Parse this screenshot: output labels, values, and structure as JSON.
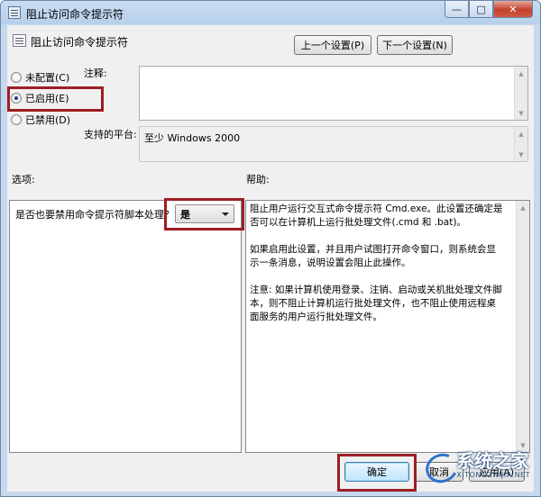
{
  "window": {
    "title": "阻止访问命令提示符",
    "controls": {
      "minimize": "—",
      "maximize": "□",
      "close": "✕"
    }
  },
  "header": {
    "setting_title": "阻止访问命令提示符",
    "prev_button": "上一个设置(P)",
    "next_button": "下一个设置(N)"
  },
  "state": {
    "options": [
      {
        "label": "未配置(C)",
        "checked": false
      },
      {
        "label": "已启用(E)",
        "checked": true
      },
      {
        "label": "已禁用(D)",
        "checked": false
      }
    ]
  },
  "comment": {
    "label": "注释:",
    "value": ""
  },
  "platform": {
    "label": "支持的平台:",
    "value": "至少 Windows 2000"
  },
  "options_section": {
    "label": "选项:",
    "question": "是否也要禁用命令提示符脚本处理？",
    "select_value": "是"
  },
  "help_section": {
    "label": "帮助:",
    "paragraphs": [
      "阻止用户运行交互式命令提示符 Cmd.exe。此设置还确定是否可以在计算机上运行批处理文件(.cmd 和 .bat)。",
      "如果启用此设置，并且用户试图打开命令窗口，则系统会显示一条消息，说明设置会阻止此操作。",
      "注意: 如果计算机使用登录、注销、启动或关机批处理文件脚本，则不阻止计算机运行批处理文件，也不阻止使用远程桌面服务的用户运行批处理文件。"
    ]
  },
  "footer": {
    "ok_button": "确定",
    "cancel_button": "取消",
    "apply_button": "应用(A)"
  },
  "watermark": {
    "main": "系统之家",
    "sub": "XITONGZHIJIA.NET"
  },
  "colors": {
    "highlight_box": "#9c1e24",
    "titlebar": "#b7cfea",
    "close_button": "#c4402a"
  }
}
